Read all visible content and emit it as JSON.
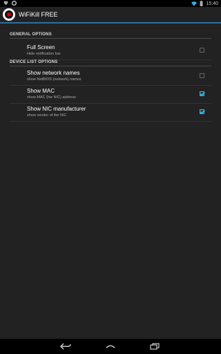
{
  "status_bar": {
    "time": "15:40"
  },
  "action_bar": {
    "title": "WiFiKill FREE"
  },
  "sections": {
    "general": {
      "header": "GENERAL OPTIONS",
      "items": [
        {
          "title": "Full Screen",
          "summary": "Hide notification bar",
          "checked": false
        }
      ]
    },
    "device_list": {
      "header": "DEVICE LIST OPTIONS",
      "items": [
        {
          "title": "Show network names",
          "summary": "show NetBIOS (network) names",
          "checked": false
        },
        {
          "title": "Show MAC",
          "summary": "show MAC (hw NIC) address",
          "checked": true
        },
        {
          "title": "Show NIC manufacturer",
          "summary": "show vendor of the NIC",
          "checked": true
        }
      ]
    }
  },
  "colors": {
    "accent": "#33b5e5",
    "action_bar_border": "#2d6fa0",
    "background": "#222222"
  }
}
